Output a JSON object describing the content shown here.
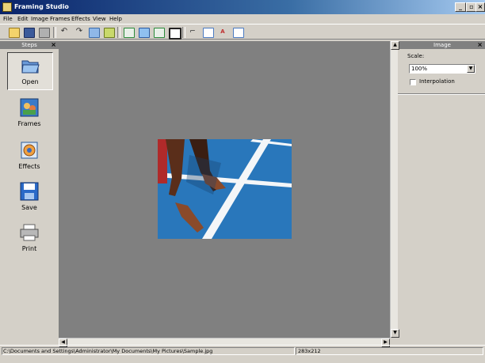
{
  "window": {
    "title": "Framing Studio"
  },
  "menu": [
    "File",
    "Edit",
    "Image",
    "Frames",
    "Effects",
    "View",
    "Help"
  ],
  "toolbar": {
    "buttons": [
      "new",
      "save",
      "print",
      "undo",
      "redo",
      "copy",
      "paste",
      "fit",
      "fill",
      "export",
      "crop-frame",
      "rotate",
      "page",
      "text",
      "document"
    ]
  },
  "steps": {
    "title": "Steps",
    "items": [
      {
        "label": "Open",
        "icon": "folder-icon",
        "selected": true
      },
      {
        "label": "Frames",
        "icon": "frames-icon",
        "selected": false
      },
      {
        "label": "Effects",
        "icon": "effects-icon",
        "selected": false
      },
      {
        "label": "Save",
        "icon": "floppy-icon",
        "selected": false
      },
      {
        "label": "Print",
        "icon": "printer-icon",
        "selected": false
      }
    ]
  },
  "image_panel": {
    "title": "Image",
    "scale_label": "Scale:",
    "scale_value": "100%",
    "interpolation_label": "Interpolation",
    "interpolation_checked": false
  },
  "status": {
    "path": "C:\\Documents and Settings\\Administrator\\My Documents\\My Pictures\\Sample.jpg",
    "dimensions": "283x212"
  },
  "colors": {
    "titlebar_start": "#0a246a",
    "canvas_bg": "#808080",
    "chrome": "#d4d0c8",
    "track_blue": "#2a7fc4"
  }
}
